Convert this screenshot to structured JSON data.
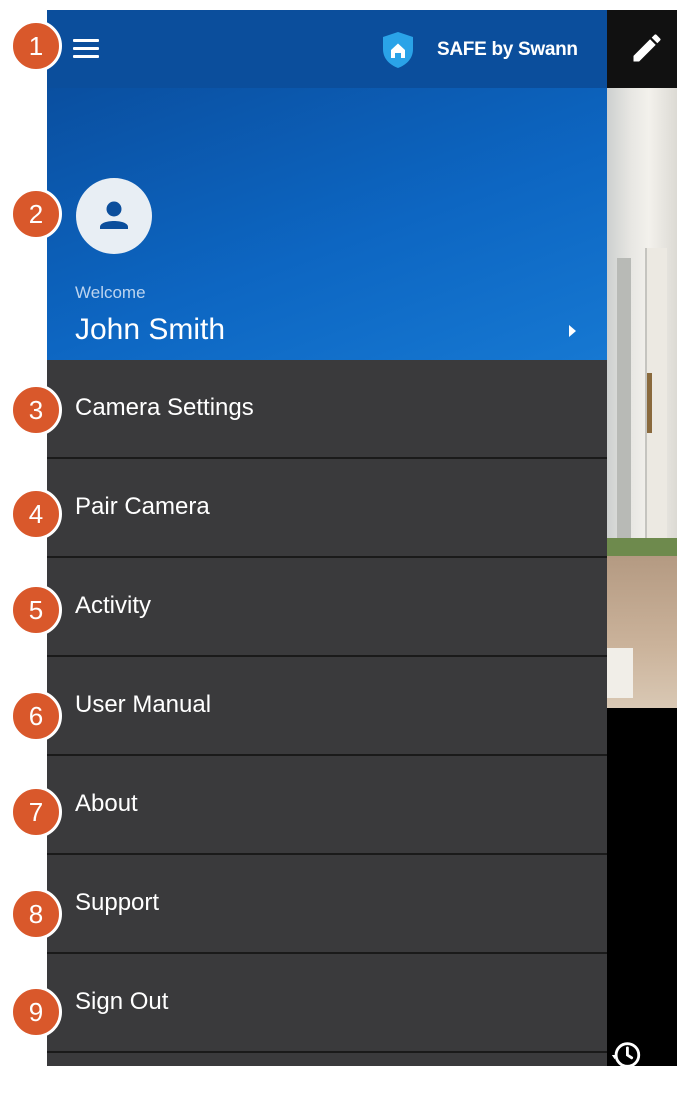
{
  "header": {
    "brand": "SAFE by Swann"
  },
  "profile": {
    "welcome": "Welcome",
    "name": "John Smith"
  },
  "menu": [
    {
      "label": "Camera Settings"
    },
    {
      "label": "Pair Camera"
    },
    {
      "label": "Activity"
    },
    {
      "label": "User Manual"
    },
    {
      "label": "About"
    },
    {
      "label": "Support"
    },
    {
      "label": "Sign Out"
    }
  ],
  "callouts": [
    "1",
    "2",
    "3",
    "4",
    "5",
    "6",
    "7",
    "8",
    "9"
  ],
  "colors": {
    "drawer_top": "#0b4e9c",
    "menu_bg": "#3a3a3c",
    "callout": "#d9582b"
  },
  "icons": [
    "hamburger-icon",
    "shield-home-icon",
    "person-icon",
    "chevron-right-icon",
    "edit-icon",
    "history-icon"
  ]
}
